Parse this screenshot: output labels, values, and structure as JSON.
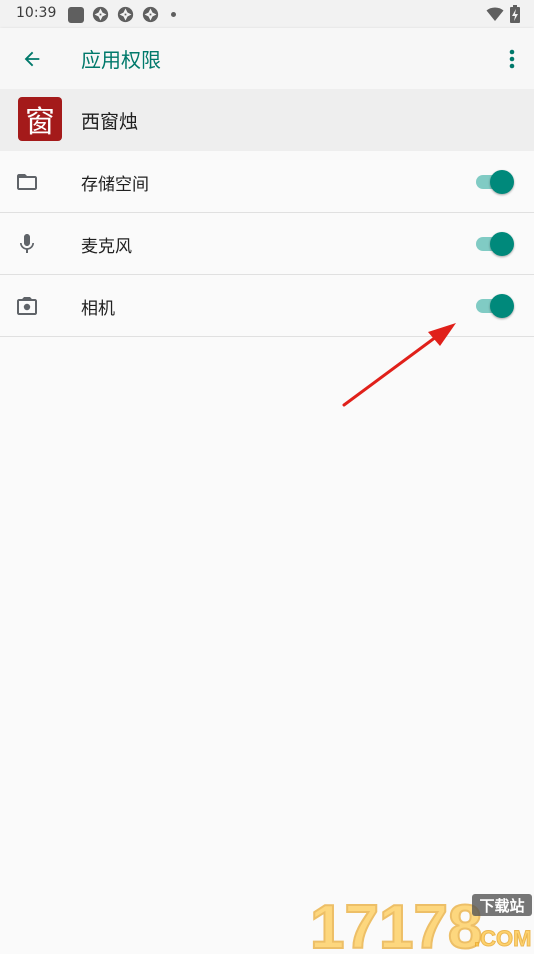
{
  "status_bar": {
    "time": "10:39",
    "icons_left": [
      "photo-app-icon",
      "aperture-icon",
      "aperture-icon",
      "aperture-icon",
      "notification-dot-icon"
    ],
    "icons_right": [
      "wifi-icon",
      "battery-charging-icon"
    ]
  },
  "app_bar": {
    "title": "应用权限",
    "back_icon": "arrow-back-icon",
    "more_icon": "more-vert-icon",
    "accent_color": "#00796b"
  },
  "app": {
    "icon_glyph": "窗",
    "icon_color": "#a41a1a",
    "name": "西窗烛"
  },
  "permissions": [
    {
      "label": "存储空间",
      "icon": "folder-icon",
      "enabled": true
    },
    {
      "label": "麦克风",
      "icon": "microphone-icon",
      "enabled": true
    },
    {
      "label": "相机",
      "icon": "camera-icon",
      "enabled": true
    }
  ],
  "toggle_colors": {
    "thumb": "#00897b",
    "track": "#80cbc4"
  },
  "annotation": {
    "arrow_color": "#e0201a"
  },
  "watermark": {
    "number": "17178",
    "tag": "下载站",
    "domain": ".COM"
  }
}
